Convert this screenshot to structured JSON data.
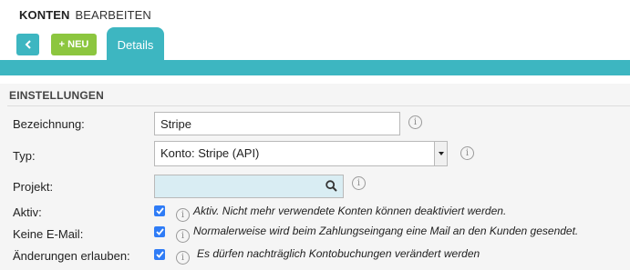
{
  "breadcrumb": {
    "section": "KONTEN",
    "action": "BEARBEITEN"
  },
  "toolbar": {
    "new_label": "+ NEU",
    "tab_details": "Details"
  },
  "section": {
    "title": "EINSTELLUNGEN"
  },
  "form": {
    "bezeichnung": {
      "label": "Bezeichnung:",
      "value": "Stripe"
    },
    "typ": {
      "label": "Typ:",
      "value": "Konto: Stripe (API)"
    },
    "projekt": {
      "label": "Projekt:",
      "value": ""
    },
    "aktiv": {
      "label": "Aktiv:",
      "checked": true,
      "hint": "Aktiv. Nicht mehr verwendete Konten können deaktiviert werden."
    },
    "keine_email": {
      "label": "Keine E-Mail:",
      "checked": true,
      "hint": "Normalerweise wird beim Zahlungseingang eine Mail an den Kunden gesendet."
    },
    "aenderungen": {
      "label": "Änderungen erlauben:",
      "checked": true,
      "hint": "Es dürfen nachträglich Kontobuchungen verändert werden"
    }
  },
  "icons": {
    "back": "chevron-left-icon",
    "search": "search-icon",
    "info": "info-icon",
    "check": "check-icon"
  },
  "colors": {
    "accent": "#3db6c1",
    "new_button": "#8cc63f",
    "checkbox": "#2f7cf6",
    "lookup_bg": "#d9edf3"
  }
}
